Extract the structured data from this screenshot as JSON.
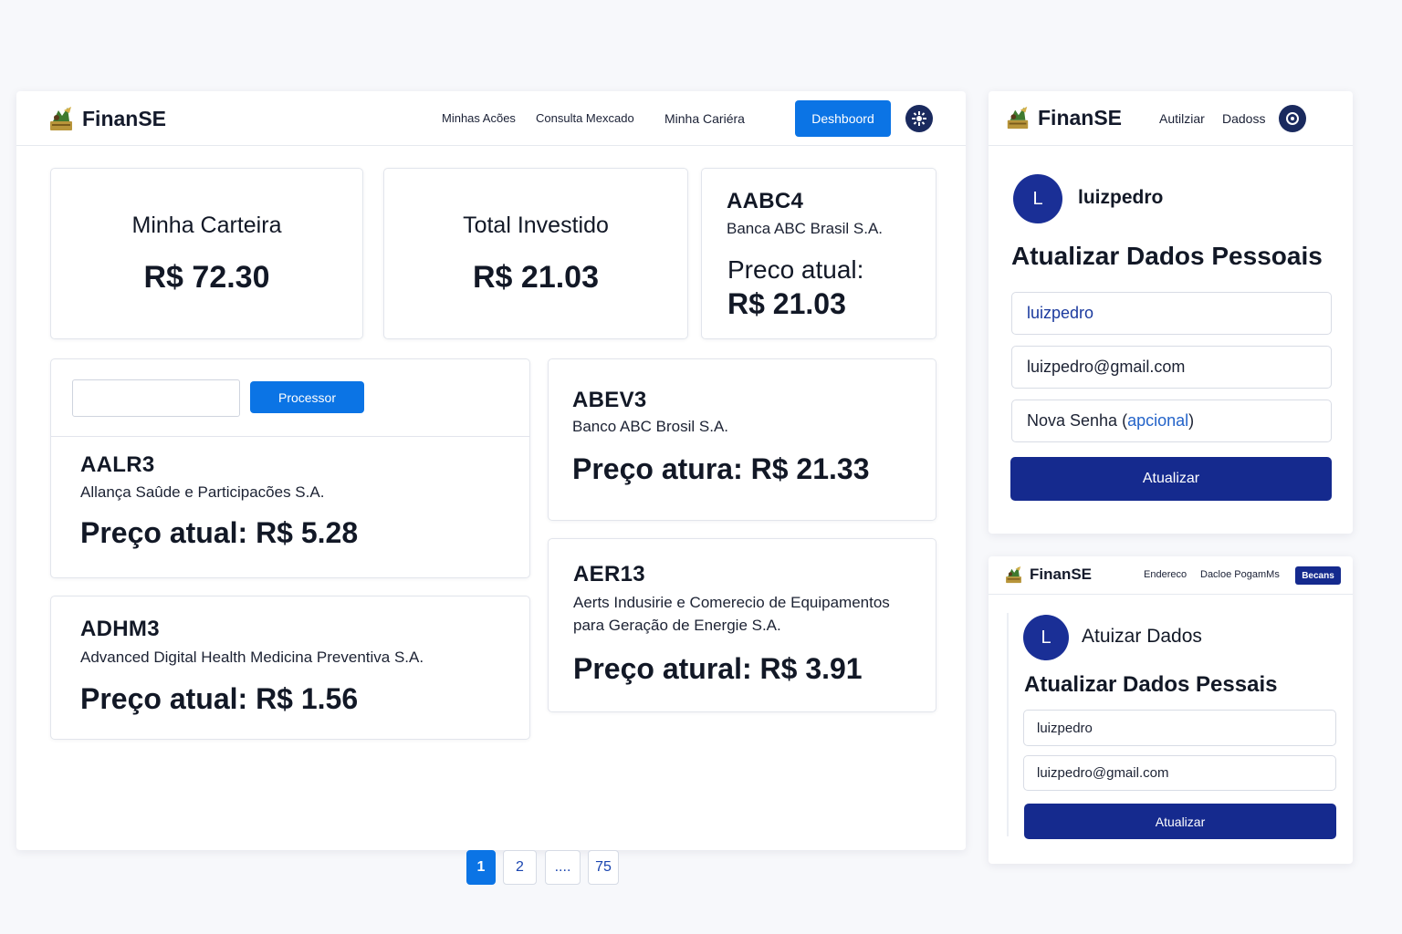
{
  "brand": "FinanSE",
  "main": {
    "nav": {
      "links": [
        "Minhas Acões",
        "Consulta Mexcado",
        "Minha Cariéra"
      ],
      "dashboard_label": "Deshboord"
    },
    "summary": {
      "carteira_label": "Minha Carteira",
      "carteira_value": "R$ 72.30",
      "investido_label": "Total Investido",
      "investido_value": "R$ 21.03"
    },
    "featured": {
      "ticker": "AABC4",
      "name": "Banca ABC Brasil S.A.",
      "price_label": "Preco atual:",
      "price_value": "R$ 21.03"
    },
    "search": {
      "value": "",
      "button_label": "Processor"
    },
    "stocks": [
      {
        "ticker": "AALR3",
        "name": "Allança Saûde e Participacões S.A.",
        "price": "Preço atual: R$ 5.28"
      },
      {
        "ticker": "ADHM3",
        "name": "Advanced Digital Health Medicina Preventiva S.A.",
        "price": "Preço atual: R$ 1.56"
      },
      {
        "ticker": "ABEV3",
        "name": "Banco ABC Brosil S.A.",
        "price": "Preço atura: R$ 21.33"
      },
      {
        "ticker": "AER13",
        "name_line1": "Aerts Indusirie e Comerecio de Equipamentos",
        "name_line2": "para Geração de Energie S.A.",
        "price": "Preço atural: R$ 3.91"
      }
    ],
    "pagination": {
      "pages": [
        "1",
        "2",
        "....",
        "75"
      ],
      "active": "1"
    }
  },
  "side1": {
    "nav": {
      "links": [
        "Autilziar",
        "Dadoss"
      ]
    },
    "avatar_initial": "L",
    "username": "luizpedro",
    "title": "Atualizar Dados Pessoais",
    "fields": {
      "username": "luizpedro",
      "email": "luizpedro@gmail.com",
      "password_prefix": "Nova Senha (",
      "password_optional": "apcional",
      "password_suffix": ")"
    },
    "submit_label": "Atualizar"
  },
  "side2": {
    "nav": {
      "links": [
        "Endereco",
        "Dacloe PogamMs"
      ],
      "badge": "Becans"
    },
    "avatar_initial": "L",
    "heading": "Atuizar Dados",
    "title": "Atualizar Dados Pessais",
    "fields": {
      "username": "luizpedro",
      "email": "luizpedro@gmail.com"
    },
    "submit_label": "Atualizar"
  },
  "colors": {
    "primary": "#0b74e5",
    "navy": "#152a8e",
    "link": "#1a45b0"
  }
}
